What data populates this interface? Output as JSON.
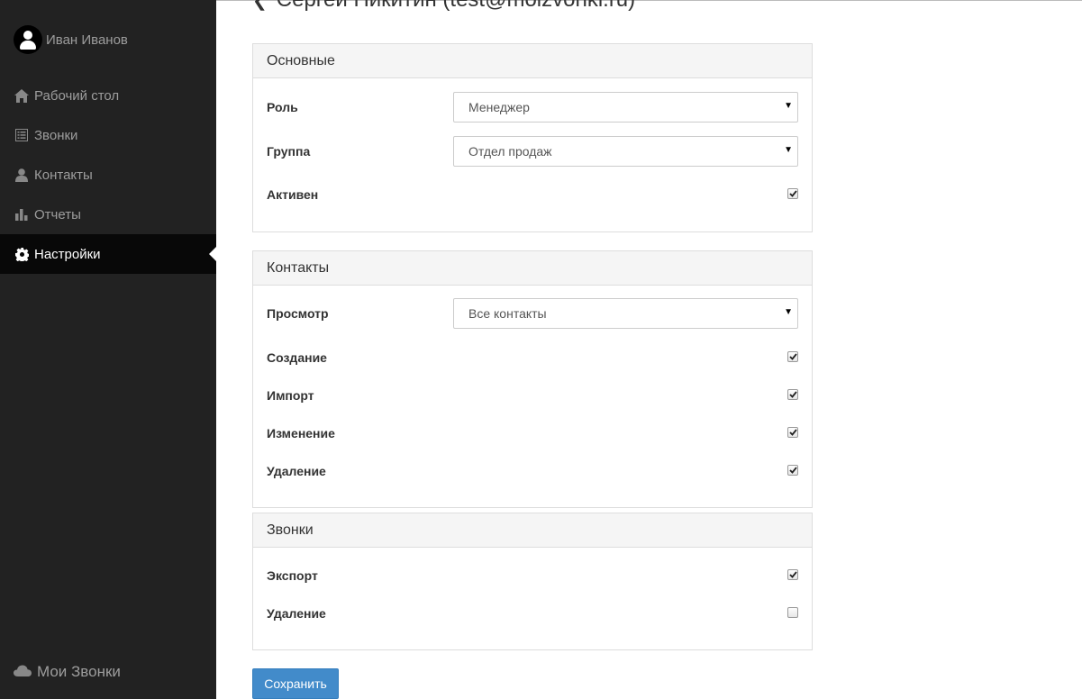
{
  "user": {
    "name": "Иван Иванов"
  },
  "nav": [
    {
      "label": "Рабочий стол",
      "icon": "home-icon"
    },
    {
      "label": "Звонки",
      "icon": "list-icon"
    },
    {
      "label": "Контакты",
      "icon": "user-icon"
    },
    {
      "label": "Отчеты",
      "icon": "bar-chart-icon"
    },
    {
      "label": "Настройки",
      "icon": "gear-icon",
      "active": true
    }
  ],
  "brand": {
    "label": "Мои Звонки",
    "icon": "cloud-icon"
  },
  "page": {
    "title": "Сергей Никитин (test@moizvonki.ru)"
  },
  "panels": {
    "basic": {
      "heading": "Основные",
      "role_label": "Роль",
      "role_value": "Менеджер",
      "group_label": "Группа",
      "group_value": "Отдел продаж",
      "active_label": "Активен",
      "active_checked": true
    },
    "contacts": {
      "heading": "Контакты",
      "view_label": "Просмотр",
      "view_value": "Все контакты",
      "create_label": "Создание",
      "create_checked": true,
      "import_label": "Импорт",
      "import_checked": true,
      "edit_label": "Изменение",
      "edit_checked": true,
      "delete_label": "Удаление",
      "delete_checked": true
    },
    "calls": {
      "heading": "Звонки",
      "export_label": "Экспорт",
      "export_checked": true,
      "delete_label": "Удаление",
      "delete_checked": false
    }
  },
  "save_label": "Сохранить",
  "colors": {
    "sidebar": "#222222",
    "active": "#080808",
    "primary": "#428bca"
  }
}
